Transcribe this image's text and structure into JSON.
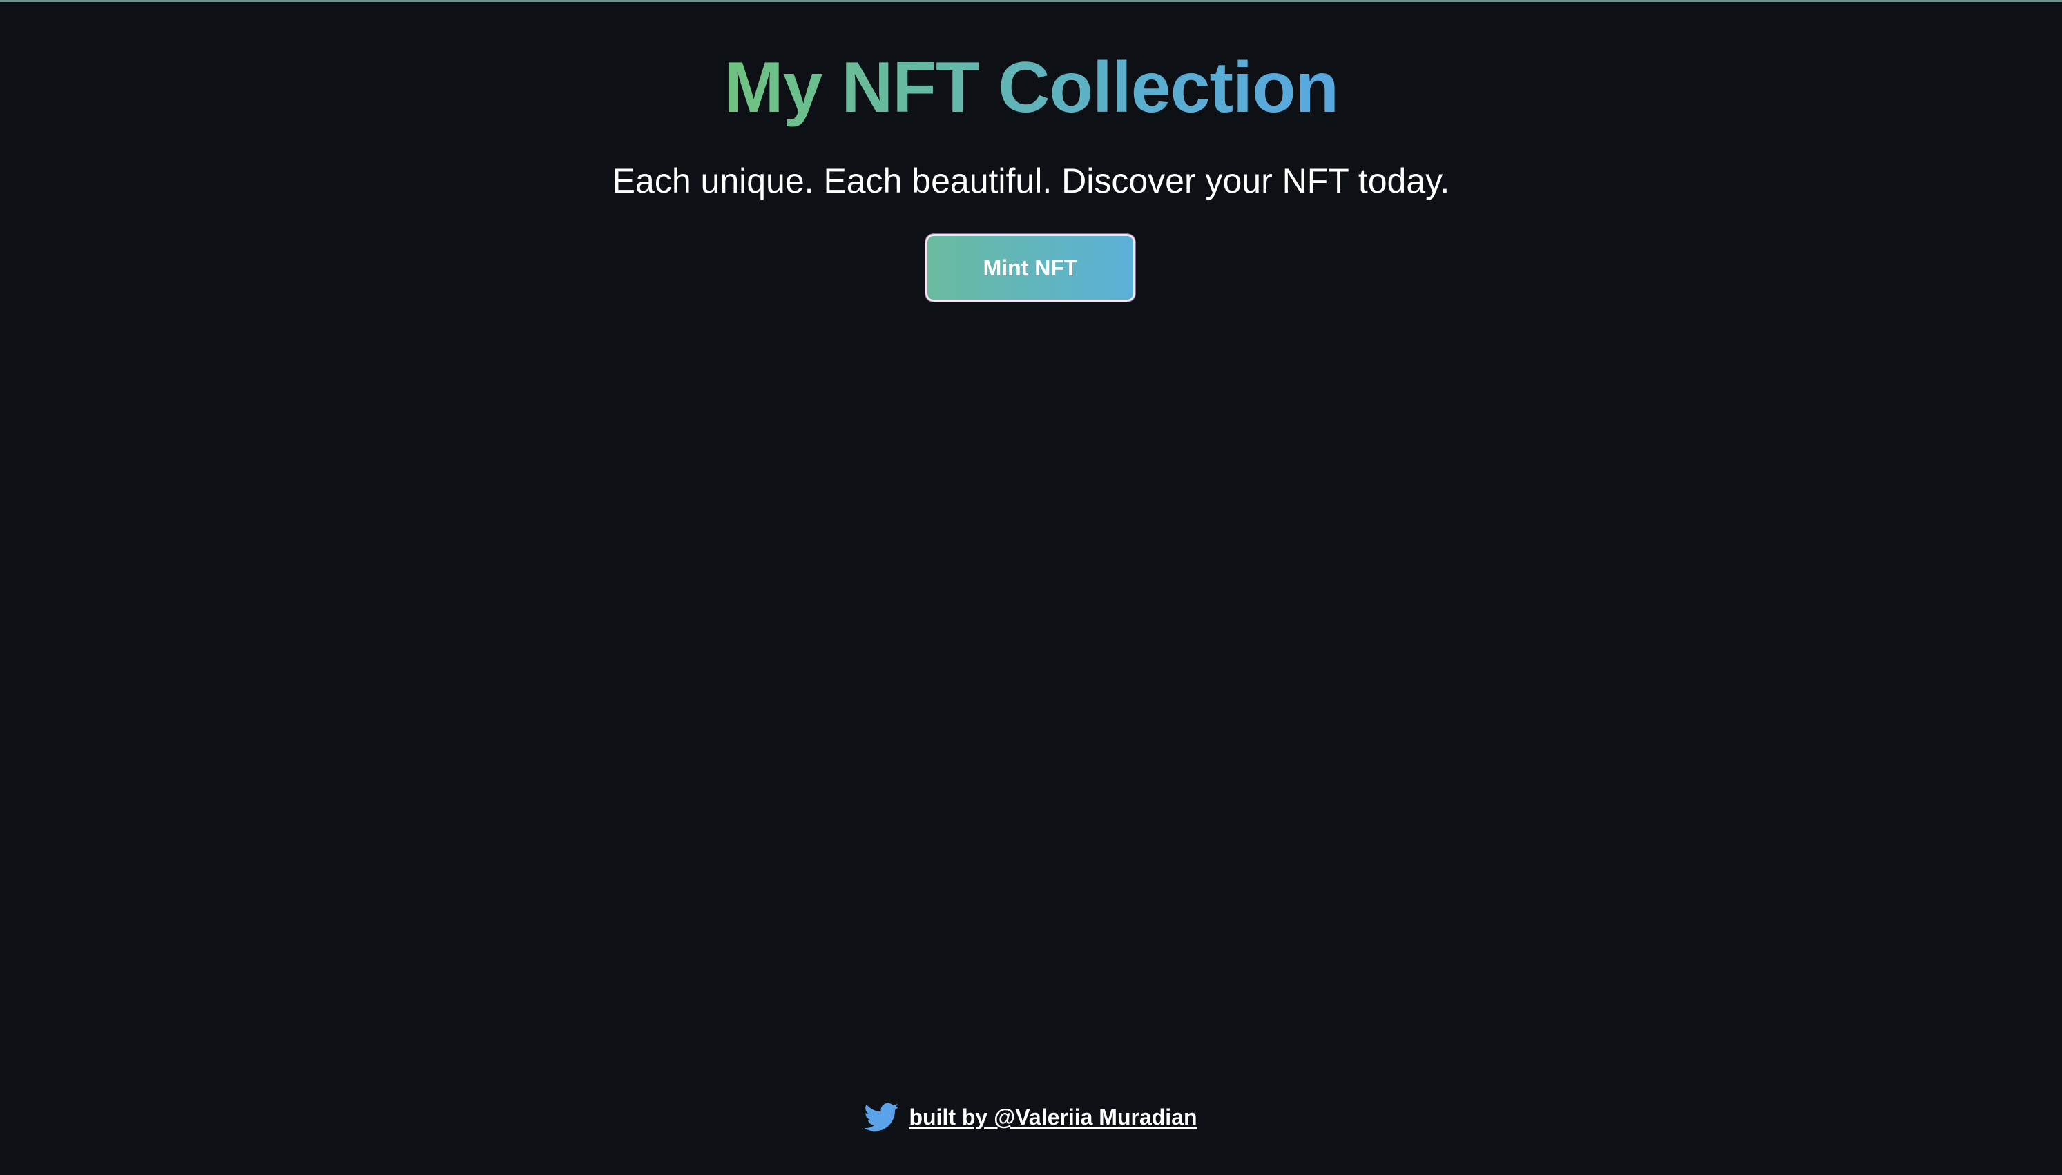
{
  "header": {
    "title": "My NFT Collection",
    "subtitle": "Each unique. Each beautiful. Discover your NFT today."
  },
  "actions": {
    "mint_label": "Mint NFT"
  },
  "footer": {
    "icon": "twitter-icon",
    "credit_text": "built by @Valeriia Muradian"
  },
  "colors": {
    "background": "#0d1116",
    "title_gradient_start": "#6fc37f",
    "title_gradient_end": "#58a8e0",
    "button_gradient_start": "#69bb9e",
    "button_gradient_end": "#5ab0d8",
    "twitter_blue": "#5aa3e8"
  }
}
